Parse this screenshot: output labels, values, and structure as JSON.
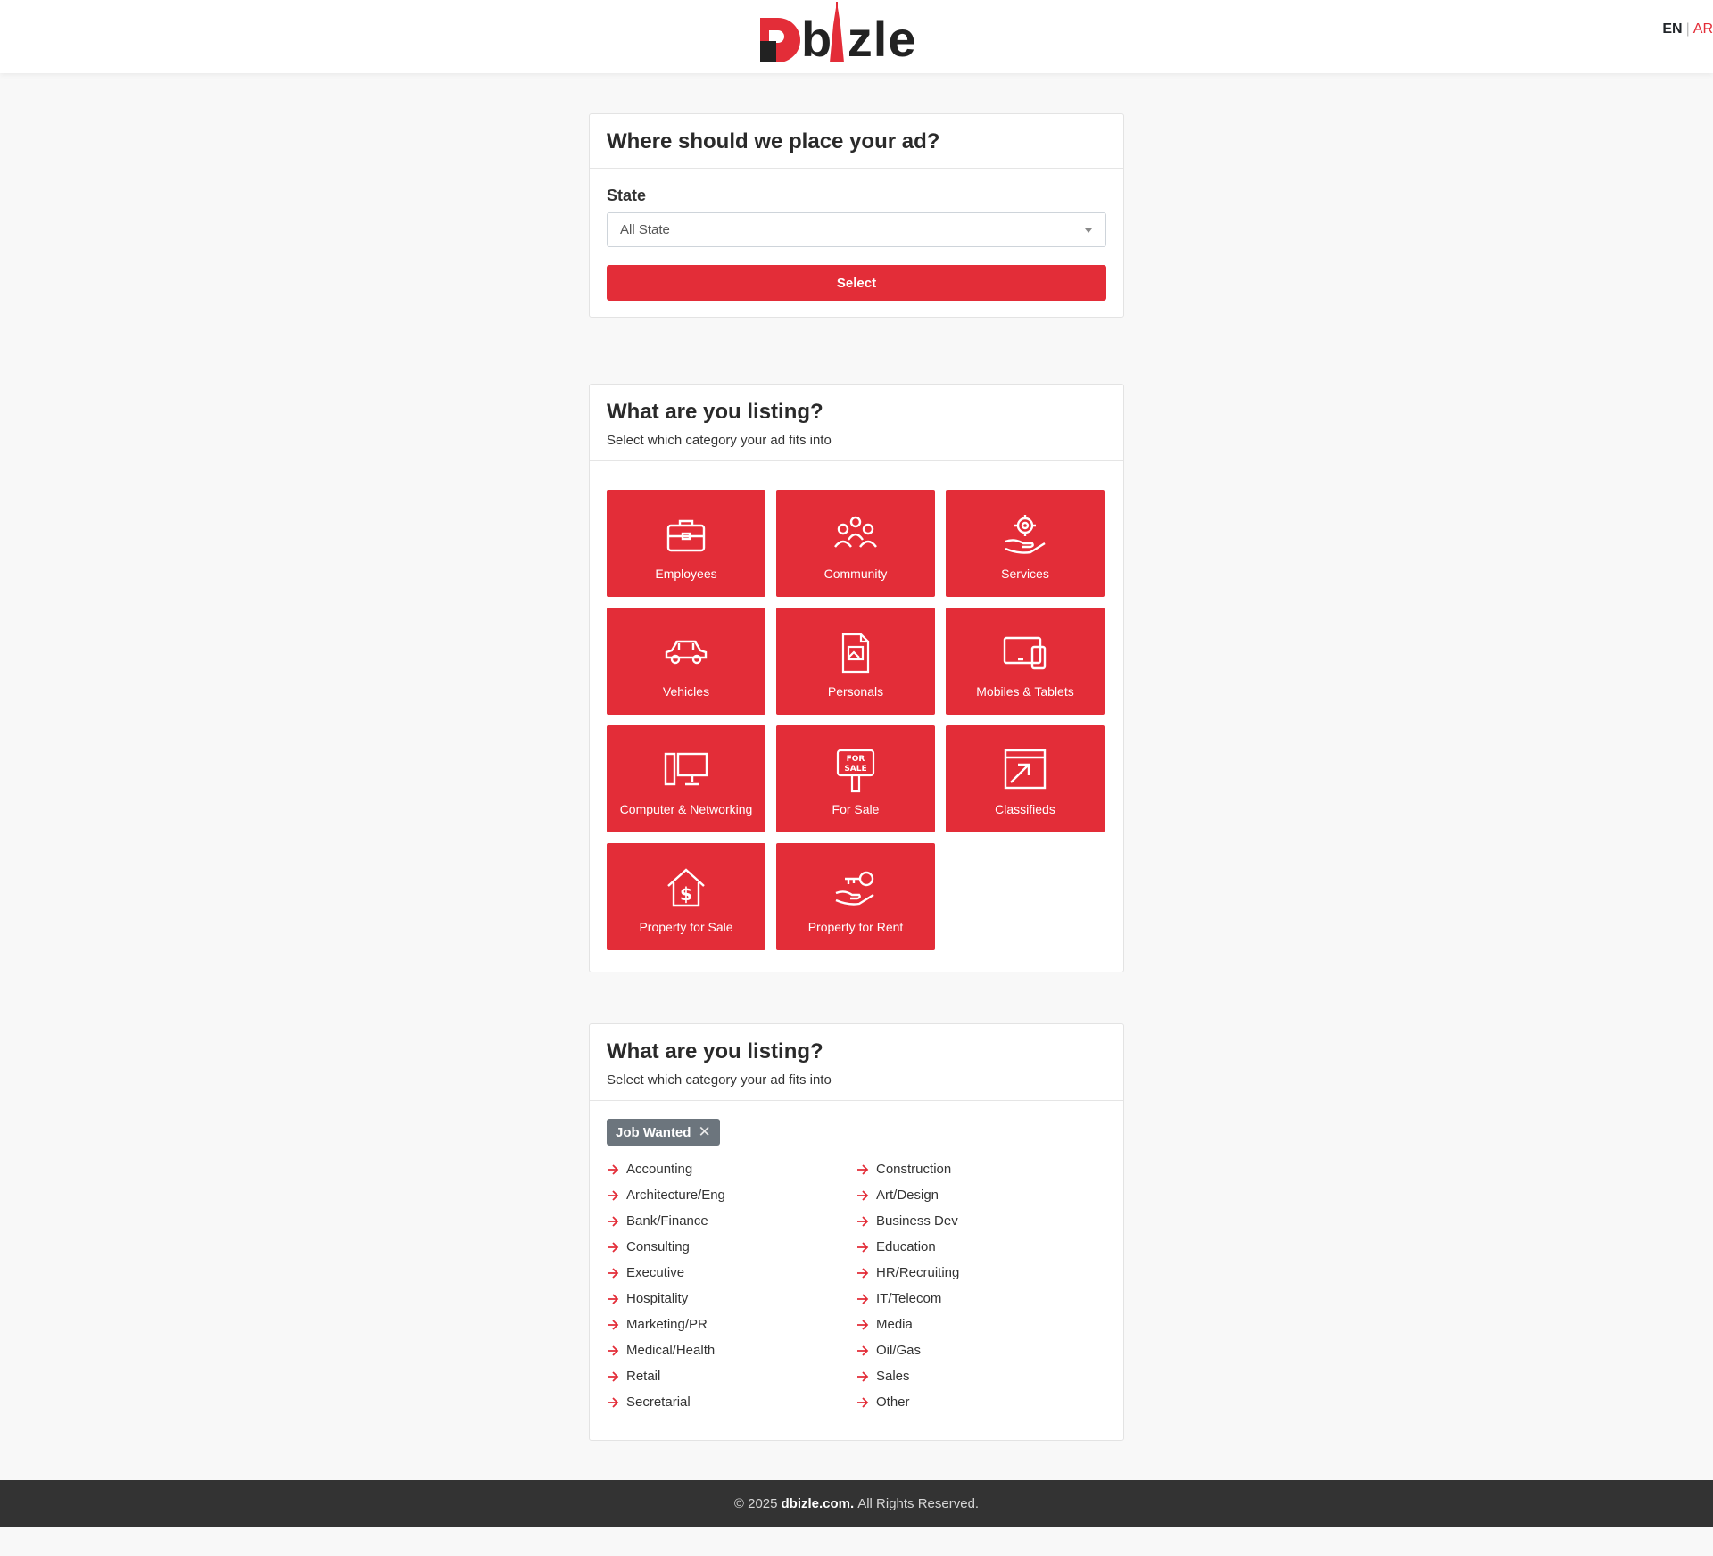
{
  "header": {
    "logo_text": "Dbizle",
    "lang_en": "EN",
    "lang_sep": "|",
    "lang_ar": "AR"
  },
  "state_card": {
    "title": "Where should we place your ad?",
    "state_label": "State",
    "state_value": "All State",
    "select_button": "Select"
  },
  "category_card": {
    "title": "What are you listing?",
    "subtitle": "Select which category your ad fits into",
    "tiles": [
      {
        "label": "Employees",
        "icon": "briefcase-icon"
      },
      {
        "label": "Community",
        "icon": "people-icon"
      },
      {
        "label": "Services",
        "icon": "gear-hand-icon"
      },
      {
        "label": "Vehicles",
        "icon": "car-icon"
      },
      {
        "label": "Personals",
        "icon": "document-image-icon"
      },
      {
        "label": "Mobiles & Tablets",
        "icon": "devices-icon"
      },
      {
        "label": "Computer & Networking",
        "icon": "computer-icon"
      },
      {
        "label": "For Sale",
        "icon": "for-sale-sign-icon"
      },
      {
        "label": "Classifieds",
        "icon": "browser-arrow-icon"
      },
      {
        "label": "Property for Sale",
        "icon": "house-dollar-icon"
      },
      {
        "label": "Property for Rent",
        "icon": "hand-key-icon"
      }
    ]
  },
  "subcategory_card": {
    "title": "What are you listing?",
    "subtitle": "Select which category your ad fits into",
    "selected_tag": "Job Wanted",
    "tag_close": "✕",
    "items": [
      "Accounting",
      "Construction",
      "Architecture/Eng",
      "Art/Design",
      "Bank/Finance",
      "Business Dev",
      "Consulting",
      "Education",
      "Executive",
      "HR/Recruiting",
      "Hospitality",
      "IT/Telecom",
      "Marketing/PR",
      "Media",
      "Medical/Health",
      "Oil/Gas",
      "Retail",
      "Sales",
      "Secretarial",
      "Other"
    ]
  },
  "footer": {
    "prefix": "© 2025",
    "site": "dbizle.com.",
    "suffix": "All Rights Reserved."
  },
  "colors": {
    "brand_red": "#e32d38",
    "footer_bg": "#333333",
    "tag_bg": "#6c757d"
  }
}
